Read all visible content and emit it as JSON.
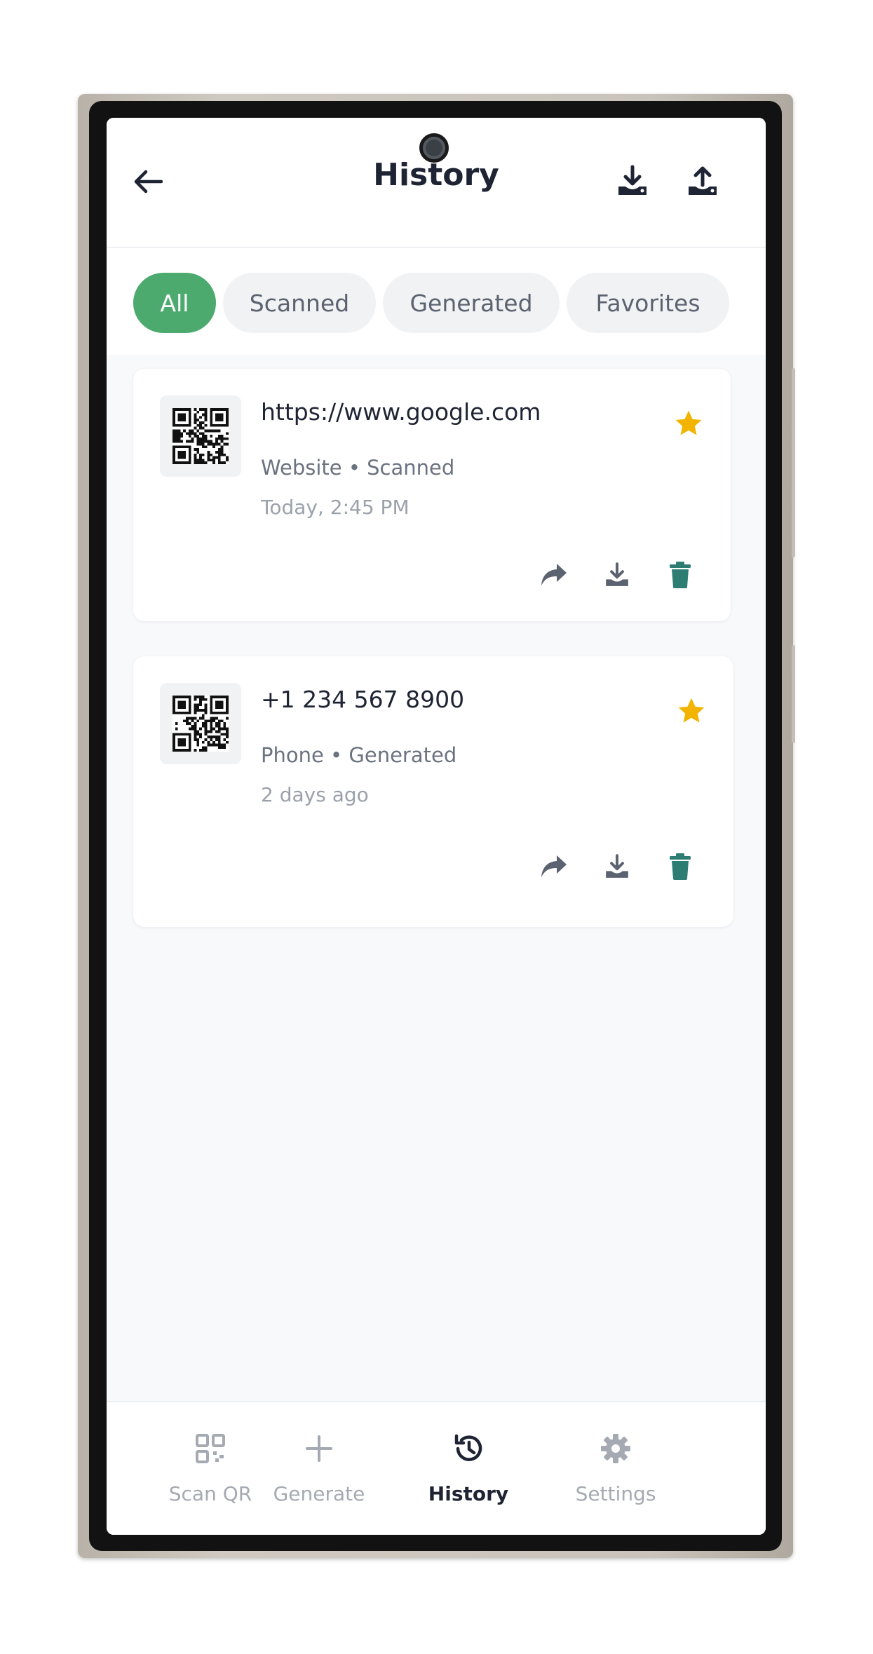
{
  "header": {
    "title": "History",
    "back_icon": "arrow-left-icon",
    "download_icon": "download-icon",
    "upload_icon": "upload-icon"
  },
  "filters": [
    {
      "label": "All",
      "active": true
    },
    {
      "label": "Scanned",
      "active": false
    },
    {
      "label": "Generated",
      "active": false
    },
    {
      "label": "Favorites",
      "active": false
    }
  ],
  "history": [
    {
      "title": "https://www.google.com",
      "meta": "Website • Scanned",
      "time": "Today, 2:45 PM",
      "favorite": true
    },
    {
      "title": "+1 234 567 8900",
      "meta": "Phone • Generated",
      "time": "2 days ago",
      "favorite": true
    }
  ],
  "nav": [
    {
      "label": "Scan QR",
      "icon": "qr-icon",
      "active": false
    },
    {
      "label": "Generate",
      "icon": "plus-icon",
      "active": false
    },
    {
      "label": "History",
      "icon": "history-icon",
      "active": true
    },
    {
      "label": "Settings",
      "icon": "gear-icon",
      "active": false
    }
  ],
  "colors": {
    "accent": "#4caa6e",
    "star": "#f2b400",
    "delete": "#2e7d73",
    "action": "#5b6270"
  }
}
